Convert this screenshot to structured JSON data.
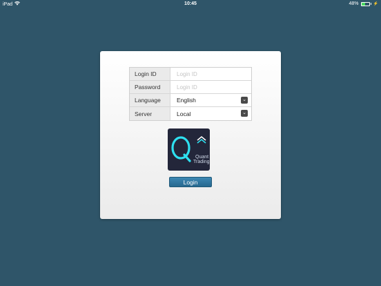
{
  "status_bar": {
    "device": "iPad",
    "time": "10:45",
    "battery_text": "48%",
    "battery_level": 0.48
  },
  "form": {
    "login_id": {
      "label": "Login ID",
      "placeholder": "Login ID",
      "value": ""
    },
    "password": {
      "label": "Password",
      "placeholder": "Login ID",
      "value": ""
    },
    "language": {
      "label": "Language",
      "selected": "English"
    },
    "server": {
      "label": "Server",
      "selected": "Local"
    }
  },
  "logo": {
    "letter": "Q",
    "line1": "Quant",
    "line2": "Trading"
  },
  "login_button": {
    "label": "Login"
  },
  "colors": {
    "background": "#2f5569",
    "accent": "#2d7aa6",
    "logo_bg": "#23263a",
    "logo_ring": "#2ee0f0"
  }
}
